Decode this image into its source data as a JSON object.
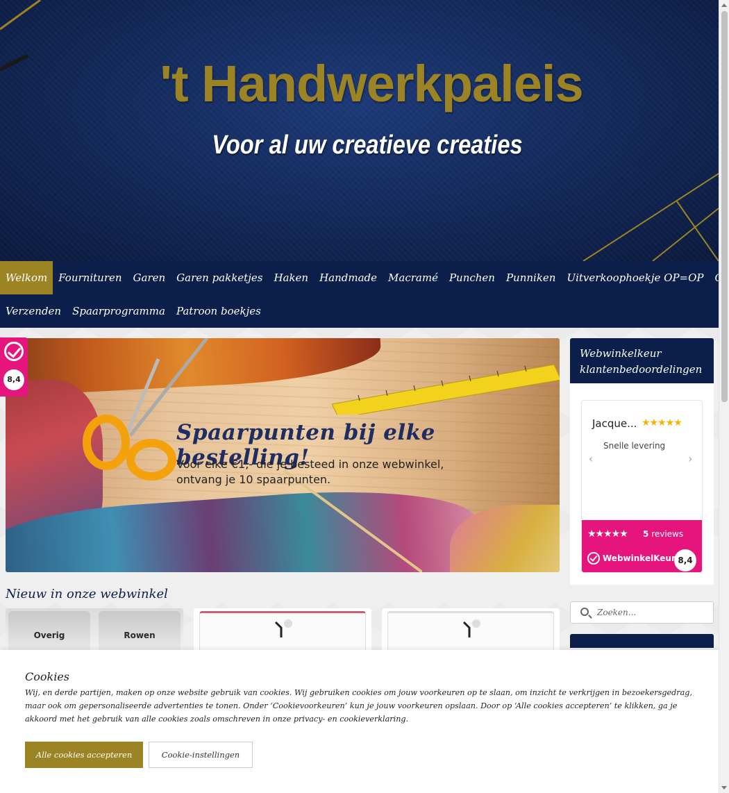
{
  "header": {
    "title": "'t Handwerkpaleis",
    "subtitle": "Voor al uw creatieve creaties"
  },
  "nav": {
    "row1": [
      "Welkom",
      "Fournituren",
      "Garen",
      "Garen pakketjes",
      "Haken",
      "Handmade",
      "Macramé",
      "Punchen",
      "Punniken",
      "Uitverkoophoekje OP=OP",
      "Contact"
    ],
    "row2": [
      "Verzenden",
      "Spaarprogramma",
      "Patroon boekjes"
    ],
    "active": "Welkom"
  },
  "side_badge": {
    "score": "8,4",
    "icon": "webwinkelkeur-check-icon"
  },
  "hero": {
    "headline": "Spaarpunten bij elke bestelling!",
    "line1": "Voor elke €1,- die je besteed in onze webwinkel,",
    "line2": "ontvang je 10 spaarpunten."
  },
  "new_section": {
    "title": "Nieuw in onze webwinkel",
    "card1_labels": [
      "Overig",
      "Rowen"
    ]
  },
  "reviews_widget": {
    "title": "Webwinkelkeur klantenbedoordelingen",
    "reviewer": "Jacque...",
    "review_stars": "★★★★★",
    "comment": "Snelle levering",
    "prev": "‹",
    "next": "›",
    "footer_stars": "★★★★★",
    "count": "5",
    "count_label": "reviews",
    "brand": "WebwinkelKeur",
    "score": "8,4"
  },
  "search": {
    "placeholder": "Zoeken..."
  },
  "cookie": {
    "title": "Cookies",
    "text": "Wij, en derde partijen, maken op onze website gebruik van cookies. Wij gebruiken cookies om jouw voorkeuren op te slaan, om inzicht te verkrijgen in bezoekersgedrag, maar ook om gepersonaliseerde advertenties te tonen. Onder ‘Cookievoorkeuren’ kun je jouw voorkeuren opslaan. Door op ‘Alle cookies accepteren’ te klikken, ga je akkoord met het gebruik van alle cookies zoals omschreven in onze privacy- en cookieverklaring.",
    "accept_label": "Alle cookies accepteren",
    "settings_label": "Cookie-instellingen"
  },
  "colors": {
    "navy": "#0b1f4a",
    "gold": "#9c8425",
    "pink": "#e5157d"
  }
}
